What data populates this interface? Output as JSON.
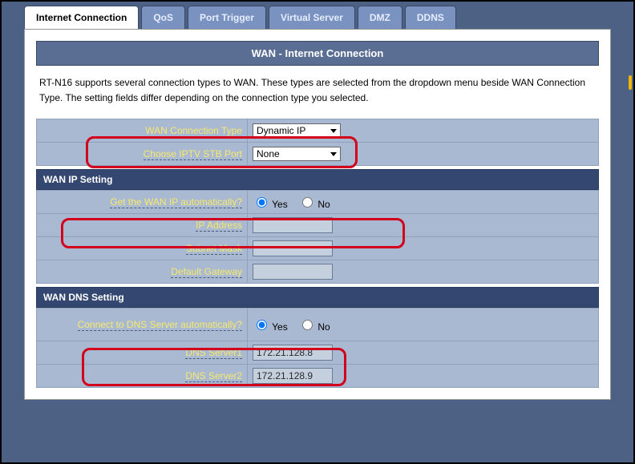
{
  "tabs": {
    "internet_connection": "Internet Connection",
    "qos": "QoS",
    "port_trigger": "Port Trigger",
    "virtual_server": "Virtual Server",
    "dmz": "DMZ",
    "ddns": "DDNS"
  },
  "panel_title": "WAN - Internet Connection",
  "intro_text": "RT-N16 supports several connection types to WAN. These types are selected from the dropdown menu beside WAN Connection Type. The setting fields differ depending on the connection type you selected.",
  "top_rows": {
    "wan_conn_label": "WAN Connection Type",
    "wan_conn_value": "Dynamic IP",
    "iptv_label": "Choose IPTV STB Port",
    "iptv_value": "None"
  },
  "wan_ip": {
    "header": "WAN IP Setting",
    "get_auto_label": "Get the WAN IP automatically?",
    "yes": "Yes",
    "no": "No",
    "ip_label": "IP Address",
    "ip_value": "",
    "mask_label": "Subnet Mask",
    "mask_value": "",
    "gw_label": "Default Gateway",
    "gw_value": ""
  },
  "wan_dns": {
    "header": "WAN DNS Setting",
    "auto_label": "Connect to DNS Server automatically?",
    "yes": "Yes",
    "no": "No",
    "dns1_label": "DNS Server1",
    "dns1_value": "172.21.128.8",
    "dns2_label": "DNS Server2",
    "dns2_value": "172.21.128.9"
  }
}
